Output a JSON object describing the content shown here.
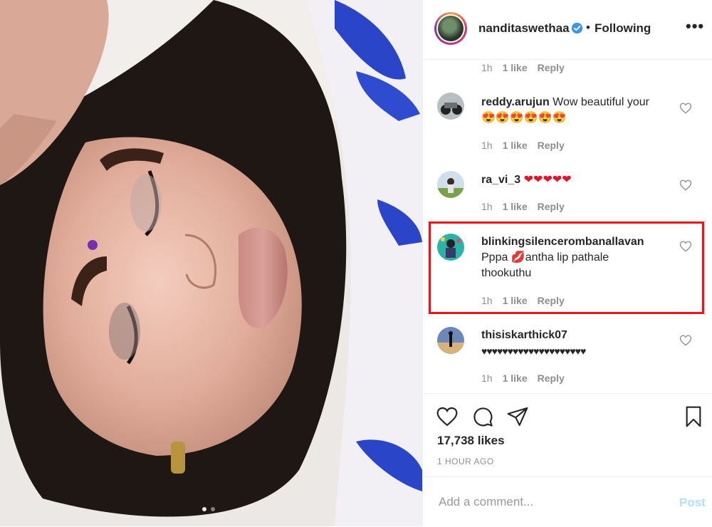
{
  "header": {
    "username": "nanditaswethaa",
    "separator": "•",
    "follow_status": "Following",
    "more": "•••"
  },
  "comments": [
    {
      "text_user": "",
      "text": "",
      "time": "1h",
      "likes": "1 like",
      "reply": "Reply"
    },
    {
      "text_user": "reddy.arujun",
      "text": "Wow beautiful your",
      "emojis": "😍😍😍😍😍😍",
      "time": "1h",
      "likes": "1 like",
      "reply": "Reply"
    },
    {
      "text_user": "ra_vi_3",
      "text": "",
      "emojis": "❤❤❤❤❤",
      "time": "1h",
      "likes": "1 like",
      "reply": "Reply"
    },
    {
      "text_user": "blinkingsilencerombanallavan",
      "text_line1": "Pppa",
      "lips": "💋",
      "text_line1b": "antha lip pathale",
      "text_line2": "thookuthu",
      "time": "1h",
      "likes": "1 like",
      "reply": "Reply"
    },
    {
      "text_user": "thisiskarthick07",
      "text": "♥♥♥♥♥♥♥♥♥♥♥♥♥♥♥♥♥♥♥♥",
      "time": "1h",
      "likes": "1 like",
      "reply": "Reply"
    }
  ],
  "footer": {
    "likes": "17,738 likes",
    "time_ago": "1 HOUR AGO",
    "comment_placeholder": "Add a comment...",
    "post_label": "Post"
  },
  "icons": {
    "like": "heart-outline-icon",
    "comment": "speech-bubble-icon",
    "share": "paper-plane-icon",
    "save": "bookmark-icon"
  },
  "colors": {
    "highlight_border": "#e8161c",
    "verified_blue": "#3897f0",
    "post_disabled": "#b2dffc"
  }
}
